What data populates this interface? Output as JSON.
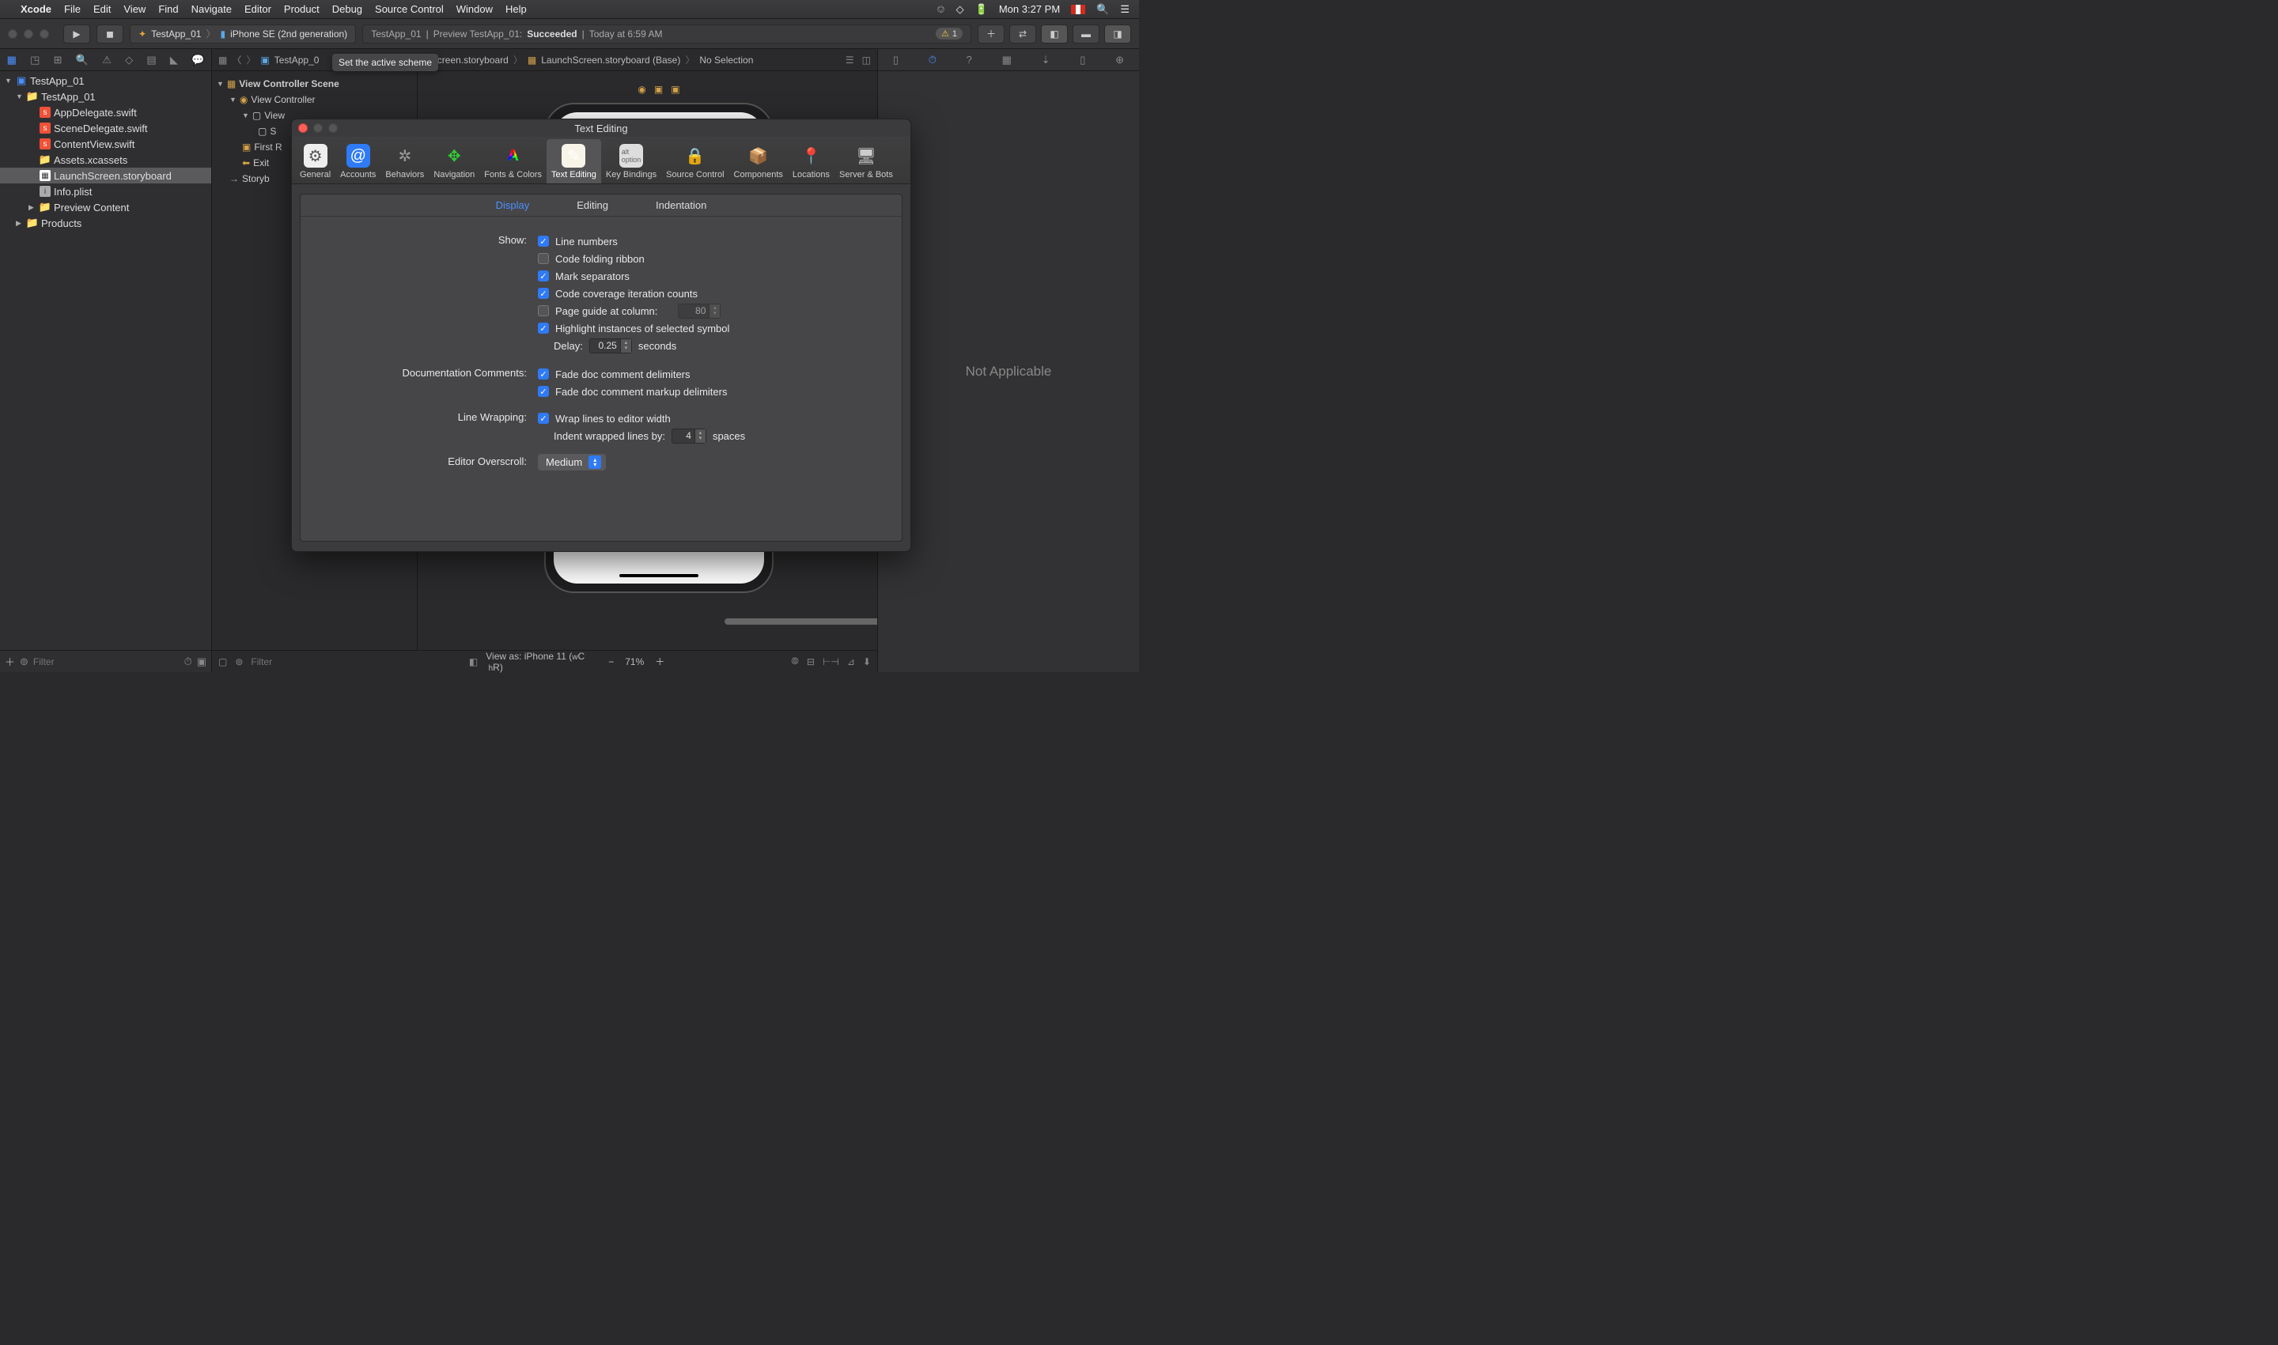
{
  "menubar": {
    "app": "Xcode",
    "items": [
      "File",
      "Edit",
      "View",
      "Find",
      "Navigate",
      "Editor",
      "Product",
      "Debug",
      "Source Control",
      "Window",
      "Help"
    ],
    "clock": "Mon 3:27 PM"
  },
  "toolbar": {
    "scheme_target": "TestApp_01",
    "scheme_device": "iPhone SE (2nd generation)",
    "status_project": "TestApp_01",
    "status_action": "Preview TestApp_01:",
    "status_result": "Succeeded",
    "status_time": "Today at 6:59 AM",
    "warning_count": "1"
  },
  "tooltip": "Set the active scheme",
  "jumpbar": {
    "items": [
      "TestApp_0",
      "LaunchScreen.storyboard",
      "LaunchScreen.storyboard (Base)",
      "No Selection"
    ]
  },
  "navigator": {
    "project": "TestApp_01",
    "group": "TestApp_01",
    "files": [
      "AppDelegate.swift",
      "SceneDelegate.swift",
      "ContentView.swift",
      "Assets.xcassets",
      "LaunchScreen.storyboard",
      "Info.plist"
    ],
    "preview_group": "Preview Content",
    "products": "Products",
    "filter_placeholder": "Filter"
  },
  "outline": {
    "scene": "View Controller Scene",
    "controller": "View Controller",
    "view": "View",
    "safeArea": "S",
    "firstResponder": "First R",
    "exit": "Exit",
    "segue": "Storyb"
  },
  "editor_bottom": {
    "view_as": "View as: iPhone 11 (",
    "view_as_suffix": "R)",
    "zoom": "71%",
    "filter_placeholder": "Filter"
  },
  "inspector": {
    "not_applicable": "Not Applicable"
  },
  "prefs": {
    "title": "Text Editing",
    "tabs": [
      "General",
      "Accounts",
      "Behaviors",
      "Navigation",
      "Fonts & Colors",
      "Text Editing",
      "Key Bindings",
      "Source Control",
      "Components",
      "Locations",
      "Server & Bots"
    ],
    "active_tab": "Text Editing",
    "subtabs": [
      "Display",
      "Editing",
      "Indentation"
    ],
    "active_subtab": "Display",
    "sections": {
      "show": {
        "label": "Show:",
        "line_numbers": "Line numbers",
        "code_folding": "Code folding ribbon",
        "mark_separators": "Mark separators",
        "code_coverage": "Code coverage iteration counts",
        "page_guide": "Page guide at column:",
        "page_guide_value": "80",
        "highlight": "Highlight instances of selected symbol",
        "delay_label": "Delay:",
        "delay_value": "0.25",
        "seconds": "seconds"
      },
      "doc": {
        "label": "Documentation Comments:",
        "fade_delim": "Fade doc comment delimiters",
        "fade_markup": "Fade doc comment markup delimiters"
      },
      "wrap": {
        "label": "Line Wrapping:",
        "wrap_lines": "Wrap lines to editor width",
        "indent_label": "Indent wrapped lines by:",
        "indent_value": "4",
        "spaces": "spaces"
      },
      "overscroll": {
        "label": "Editor Overscroll:",
        "value": "Medium"
      }
    }
  }
}
